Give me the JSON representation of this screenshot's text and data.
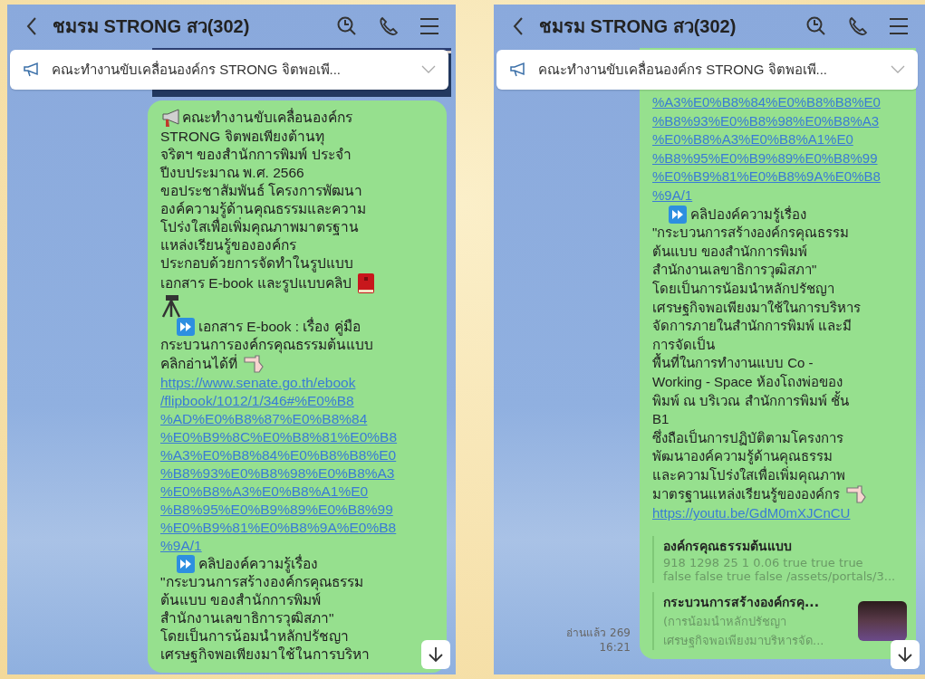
{
  "screens": [
    {
      "title": "ชมรม STRONG สว(302)",
      "top_image": true,
      "announcement": "คณะทำงานขับเคลื่อนองค์กร STRONG จิตพอเพี...",
      "bubble_cut_top": false,
      "lines": [
        {
          "kind": "megaphone",
          "text": "คณะทำงานขับเคลื่อนองค์กร"
        },
        {
          "kind": "text",
          "text": "STRONG จิตพอเพียงต้านทุ"
        },
        {
          "kind": "text",
          "text": "จริตฯ ของสำนักการพิมพ์ ประจำ"
        },
        {
          "kind": "text",
          "text": "ปีงบประมาณ พ.ศ. 2566"
        },
        {
          "kind": "text",
          "text": "ขอประชาสัมพันธ์ โครงการพัฒนา"
        },
        {
          "kind": "text",
          "text": "องค์ความรู้ด้านคุณธรรมและความ"
        },
        {
          "kind": "text",
          "text": "โปร่งใสเพื่อเพิ่มคุณภาพมาตรฐาน"
        },
        {
          "kind": "text",
          "text": "แหล่งเรียนรู้ขององค์กร"
        },
        {
          "kind": "text",
          "text": "ประกอบด้วยการจัดทำในรูปแบบ"
        },
        {
          "kind": "book",
          "text": "เอกสาร E-book และรูปแบบคลิป"
        },
        {
          "kind": "tripod"
        },
        {
          "kind": "ff",
          "text": "เอกสาร E-book : เรื่อง คู่มือ"
        },
        {
          "kind": "text",
          "text": "กระบวนการองค์กรคุณธรรมต้นแบบ"
        },
        {
          "kind": "point",
          "text": "คลิกอ่านได้ที่"
        },
        {
          "kind": "link",
          "text": "https://www.senate.go.th/ebook"
        },
        {
          "kind": "link",
          "text": "/flipbook/1012/1/346#%E0%B8"
        },
        {
          "kind": "link",
          "text": "%AD%E0%B8%87%E0%B8%84"
        },
        {
          "kind": "link",
          "text": "%E0%B9%8C%E0%B8%81%E0%B8"
        },
        {
          "kind": "link",
          "text": "%A3%E0%B8%84%E0%B8%B8%E0"
        },
        {
          "kind": "link",
          "text": "%B8%93%E0%B8%98%E0%B8%A3"
        },
        {
          "kind": "link",
          "text": "%E0%B8%A3%E0%B8%A1%E0"
        },
        {
          "kind": "link",
          "text": "%B8%95%E0%B9%89%E0%B8%99"
        },
        {
          "kind": "link",
          "text": "%E0%B9%81%E0%B8%9A%E0%B8"
        },
        {
          "kind": "link",
          "text": "%9A/1"
        },
        {
          "kind": "ff",
          "text": "คลิปองค์ความรู้เรื่อง"
        },
        {
          "kind": "text",
          "text": "\"กระบวนการสร้างองค์กรคุณธรรม"
        },
        {
          "kind": "text",
          "text": "ต้นแบบ ของสำนักการพิมพ์"
        },
        {
          "kind": "text",
          "text": "สำนักงานเลขาธิการวุฒิสภา\""
        },
        {
          "kind": "text",
          "text": "โดยเป็นการน้อมนำหลักปรัชญา"
        },
        {
          "kind": "text",
          "text": "เศรษฐกิจพอเพียงมาใช้ในการบริหา"
        }
      ]
    },
    {
      "title": "ชมรม STRONG สว(302)",
      "announcement": "คณะทำงานขับเคลื่อนองค์กร STRONG จิตพอเพี...",
      "bubble_cut_top": true,
      "lines": [
        {
          "kind": "link",
          "text": "%A3%E0%B8%84%E0%B8%B8%E0"
        },
        {
          "kind": "link",
          "text": "%B8%93%E0%B8%98%E0%B8%A3"
        },
        {
          "kind": "link",
          "text": "%E0%B8%A3%E0%B8%A1%E0"
        },
        {
          "kind": "link",
          "text": "%B8%95%E0%B9%89%E0%B8%99"
        },
        {
          "kind": "link",
          "text": "%E0%B9%81%E0%B8%9A%E0%B8"
        },
        {
          "kind": "link",
          "text": "%9A/1"
        },
        {
          "kind": "ff",
          "text": "คลิปองค์ความรู้เรื่อง"
        },
        {
          "kind": "text",
          "text": "\"กระบวนการสร้างองค์กรคุณธรรม"
        },
        {
          "kind": "text",
          "text": "ต้นแบบ ของสำนักการพิมพ์"
        },
        {
          "kind": "text",
          "text": "สำนักงานเลขาธิการวุฒิสภา\""
        },
        {
          "kind": "text",
          "text": "โดยเป็นการน้อมนำหลักปรัชญา"
        },
        {
          "kind": "text",
          "text": "เศรษฐกิจพอเพียงมาใช้ในการบริหาร"
        },
        {
          "kind": "text",
          "text": "จัดการภายในสำนักการพิมพ์ และมี"
        },
        {
          "kind": "text",
          "text": "การจัดเป็น"
        },
        {
          "kind": "text",
          "text": "พื้นที่ในการทำงานแบบ Co -"
        },
        {
          "kind": "text",
          "text": "Working - Space ห้องโถงพ่อของ"
        },
        {
          "kind": "text",
          "text": "พิมพ์ ณ บริเวณ สำนักการพิมพ์ ชั้น"
        },
        {
          "kind": "text",
          "text": "B1"
        },
        {
          "kind": "text",
          "text": "ซึ่งถือเป็นการปฏิบัติตามโครงการ"
        },
        {
          "kind": "text",
          "text": "พัฒนาองค์ความรู้ด้านคุณธรรม"
        },
        {
          "kind": "text",
          "text": "และความโปร่งใสเพื่อเพิ่มคุณภาพ"
        },
        {
          "kind": "point",
          "text": "มาตรฐานแหล่งเรียนรู้ขององค์กร"
        },
        {
          "kind": "link",
          "text": "https://youtu.be/GdM0mXJCnCU"
        }
      ],
      "previews": [
        {
          "title": "องค์กรคุณธรรมต้นแบบ",
          "description": [
            "918 1298 25 1 0.06 true true true",
            "false false true false /assets/portals/3..."
          ]
        },
        {
          "title": "กระบวนการสร้างองค์กรคุ...",
          "description": [
            "(การน้อมนำหลักปรัชญา",
            "เศรษฐกิจพอเพียงมาบริหารจัด..."
          ],
          "thumbnail": true
        }
      ],
      "read_status": "อ่านแล้ว 269",
      "time": "16:21"
    }
  ]
}
